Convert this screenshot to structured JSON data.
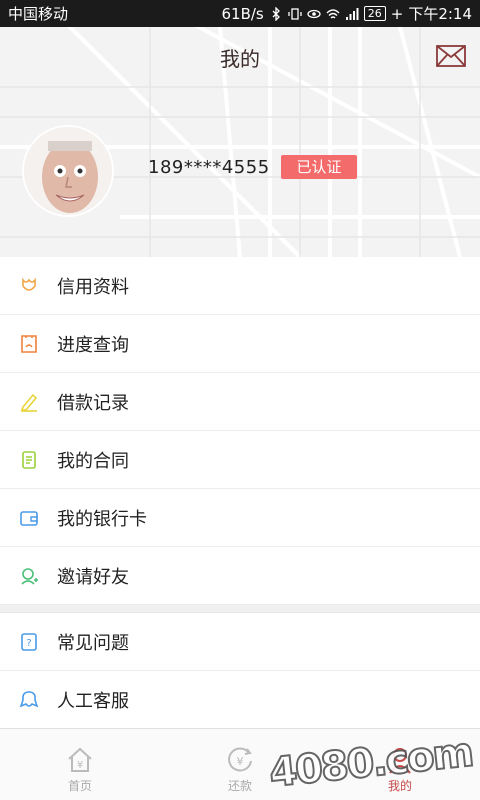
{
  "status": {
    "carrier": "中国移动",
    "speed": "61B/s",
    "battery": "26",
    "time": "下午2:14"
  },
  "header": {
    "title": "我的",
    "phone": "189****4555",
    "verified_badge": "已认证"
  },
  "menu_group_1": [
    {
      "label": "信用资料",
      "icon": "tulip-icon",
      "color": "#f0a64a"
    },
    {
      "label": "进度查询",
      "icon": "ticket-icon",
      "color": "#f0823a"
    },
    {
      "label": "借款记录",
      "icon": "pencil-icon",
      "color": "#e8d53a"
    },
    {
      "label": "我的合同",
      "icon": "document-icon",
      "color": "#9ad13a"
    },
    {
      "label": "我的银行卡",
      "icon": "wallet-icon",
      "color": "#4a9be8"
    },
    {
      "label": "邀请好友",
      "icon": "add-friend-icon",
      "color": "#4ac07a"
    }
  ],
  "menu_group_2": [
    {
      "label": "常见问题",
      "icon": "question-icon",
      "color": "#4a9be8"
    },
    {
      "label": "人工客服",
      "icon": "chat-bubble-icon",
      "color": "#4a9be8"
    }
  ],
  "tabs": [
    {
      "label": "首页",
      "icon": "home-icon"
    },
    {
      "label": "还款",
      "icon": "yuan-icon"
    },
    {
      "label": "我的",
      "icon": "person-icon"
    }
  ],
  "watermark": "4080.com"
}
